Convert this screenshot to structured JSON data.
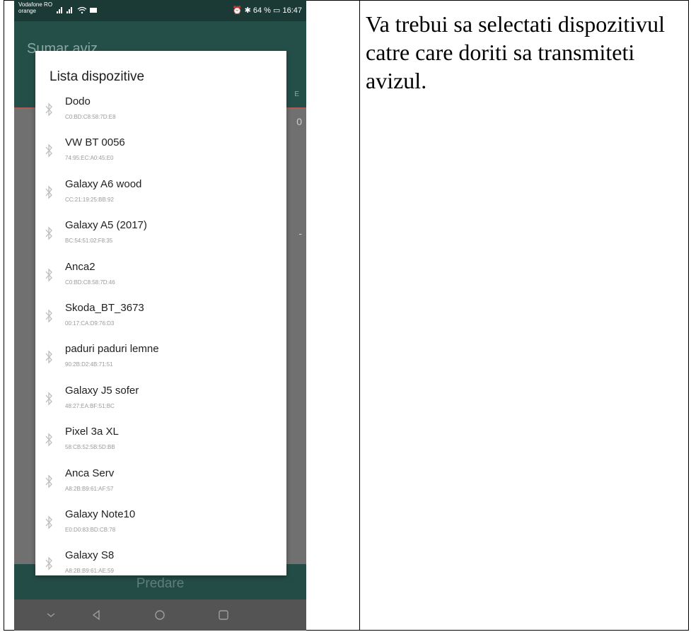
{
  "status": {
    "carrier_line1": "Vodafone RO",
    "carrier_line2": "orange",
    "battery": "64 %",
    "time": "16:47"
  },
  "app": {
    "title": "Sumar aviz",
    "right_hint": "E",
    "value_hint": "0",
    "dash_hint": "-",
    "bottom_button": "Predare"
  },
  "dialog": {
    "title": "Lista dispozitive",
    "devices": [
      {
        "name": "Dodo",
        "mac": "C0:BD:C8:58:7D:E8"
      },
      {
        "name": "VW BT 0056",
        "mac": "74:95:EC:A0:45:E0"
      },
      {
        "name": "Galaxy A6 wood",
        "mac": "CC:21:19:25:BB:92"
      },
      {
        "name": "Galaxy A5 (2017)",
        "mac": "BC:54:51:02:F8:35"
      },
      {
        "name": "Anca2",
        "mac": "C0:BD:C8:58:7D:46"
      },
      {
        "name": "Skoda_BT_3673",
        "mac": "00:17:CA:D9:76:D3"
      },
      {
        "name": "paduri paduri lemne",
        "mac": "90:2B:D2:4B:71:51"
      },
      {
        "name": "Galaxy J5 sofer",
        "mac": "48:27:EA:BF:51:BC"
      },
      {
        "name": "Pixel 3a XL",
        "mac": "58:CB:52:5B:5D:BB"
      },
      {
        "name": "Anca Serv",
        "mac": "A8:2B:B9:61:AF:57"
      },
      {
        "name": "Galaxy Note10",
        "mac": "E0:D0:83:BD:CB:78"
      },
      {
        "name": "Galaxy S8",
        "mac": "A8:2B:B9:61:AE:59"
      }
    ]
  },
  "instruction": "Va trebui sa selectati dispozitivul catre care doriti sa transmiteti avizul.",
  "colors": {
    "statusbar": "#1b3a36",
    "appbar": "#244f49",
    "accent": "#b05a52",
    "bluetooth_icon": "#bdbdbd"
  }
}
